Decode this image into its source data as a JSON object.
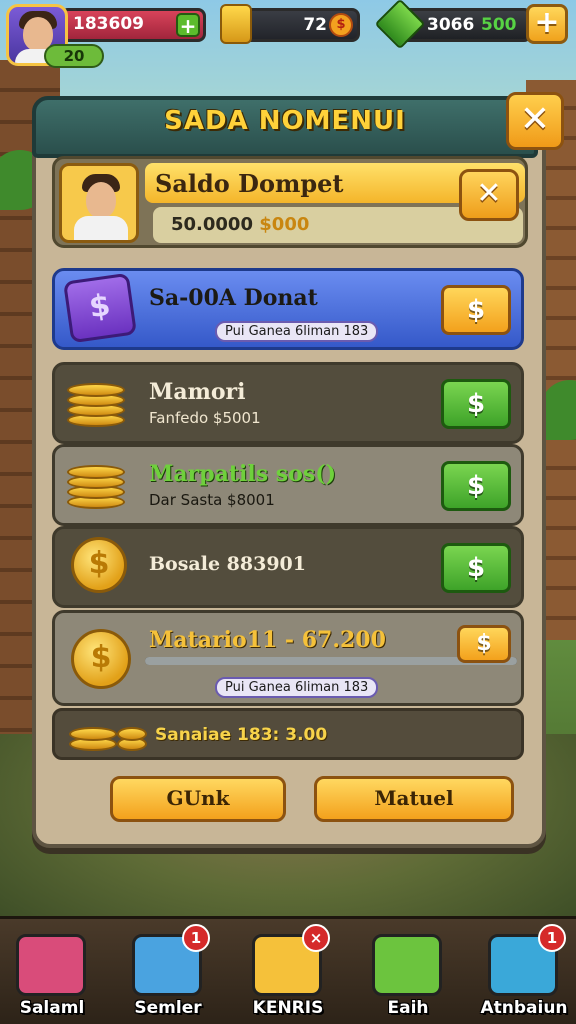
{
  "hud": {
    "level": "20",
    "health_value": "183609",
    "coins_value": "72",
    "gems_value": "3066",
    "gems_green_value": "500"
  },
  "panel": {
    "title": "SADA NOMENUI"
  },
  "wallet": {
    "title": "Saldo Dompet",
    "balance_text": "50.0000",
    "balance_gold": "$000"
  },
  "rows": [
    {
      "name": "Sa-00A Donat",
      "detail": "",
      "chip": "Pui Ganea 6liman 183",
      "button": "$",
      "style": "blue"
    },
    {
      "name": "Mamori",
      "detail": "Fanfedo $5001",
      "chip": "",
      "button": "$",
      "style": "dark"
    },
    {
      "name": "Marpatils sos()",
      "detail": "Dar Sasta $8001",
      "chip": "",
      "button": "$",
      "style": "light"
    },
    {
      "name": "Bosale 883901",
      "detail": "",
      "chip": "",
      "button": "$",
      "style": "dark"
    },
    {
      "name": "Matario11 - 67.200",
      "detail": "",
      "chip": "Pui Ganea 6liman 183",
      "button": "$",
      "style": "light",
      "progress": 1.0
    }
  ],
  "total": {
    "label": "Sanaiae 183: 3.00"
  },
  "actions": {
    "left": "GUnk",
    "right": "Matuel"
  },
  "nav": [
    {
      "label": "Salaml",
      "badge": "",
      "color": "#d94c7a"
    },
    {
      "label": "Semler",
      "badge": "1",
      "color": "#4aa3e0"
    },
    {
      "label": "KENRIS",
      "badge": "×",
      "color": "#f5c13a"
    },
    {
      "label": "Eaih",
      "badge": "",
      "color": "#6cc43e"
    },
    {
      "label": "Atnbaiun",
      "badge": "1",
      "color": "#3aa8d9"
    }
  ]
}
